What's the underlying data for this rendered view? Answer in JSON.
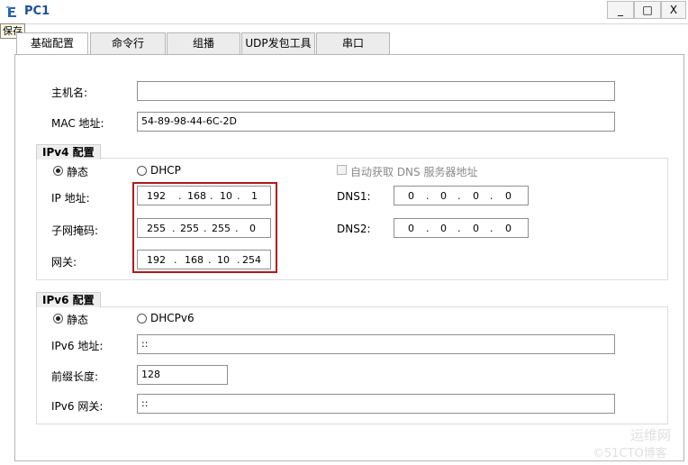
{
  "window": {
    "title": "PC1",
    "minimize_label": "_",
    "maximize_label": "□",
    "close_label": "X",
    "tooltip": "保存"
  },
  "tabs": [
    {
      "label": "基础配置",
      "active": true
    },
    {
      "label": "命令行"
    },
    {
      "label": "组播"
    },
    {
      "label": "UDP发包工具"
    },
    {
      "label": "串口"
    }
  ],
  "basic": {
    "hostname_label": "主机名:",
    "hostname_value": "",
    "mac_label": "MAC 地址:",
    "mac_value": "54-89-98-44-6C-2D"
  },
  "ipv4": {
    "group_title": "IPv4 配置",
    "static_label": "静态",
    "dhcp_label": "DHCP",
    "auto_dns_label": "自动获取 DNS 服务器地址",
    "ip_label": "IP 地址:",
    "ip": [
      "192",
      "168",
      "10",
      "1"
    ],
    "mask_label": "子网掩码:",
    "mask": [
      "255",
      "255",
      "255",
      "0"
    ],
    "gateway_label": "网关:",
    "gateway": [
      "192",
      "168",
      "10",
      "254"
    ],
    "dns1_label": "DNS1:",
    "dns1": [
      "0",
      "0",
      "0",
      "0"
    ],
    "dns2_label": "DNS2:",
    "dns2": [
      "0",
      "0",
      "0",
      "0"
    ],
    "static_selected": true
  },
  "ipv6": {
    "group_title": "IPv6 配置",
    "static_label": "静态",
    "dhcp_label": "DHCPv6",
    "addr_label": "IPv6 地址:",
    "addr_value": "::",
    "prefix_label": "前缀长度:",
    "prefix_value": "128",
    "gateway_label": "IPv6 网关:",
    "gateway_value": "::",
    "static_selected": true
  },
  "watermark": {
    "line1": "运维网",
    "line2": "©51CTO博客"
  },
  "colors": {
    "title": "#1a4f9e",
    "highlight": "#b01a1a"
  }
}
